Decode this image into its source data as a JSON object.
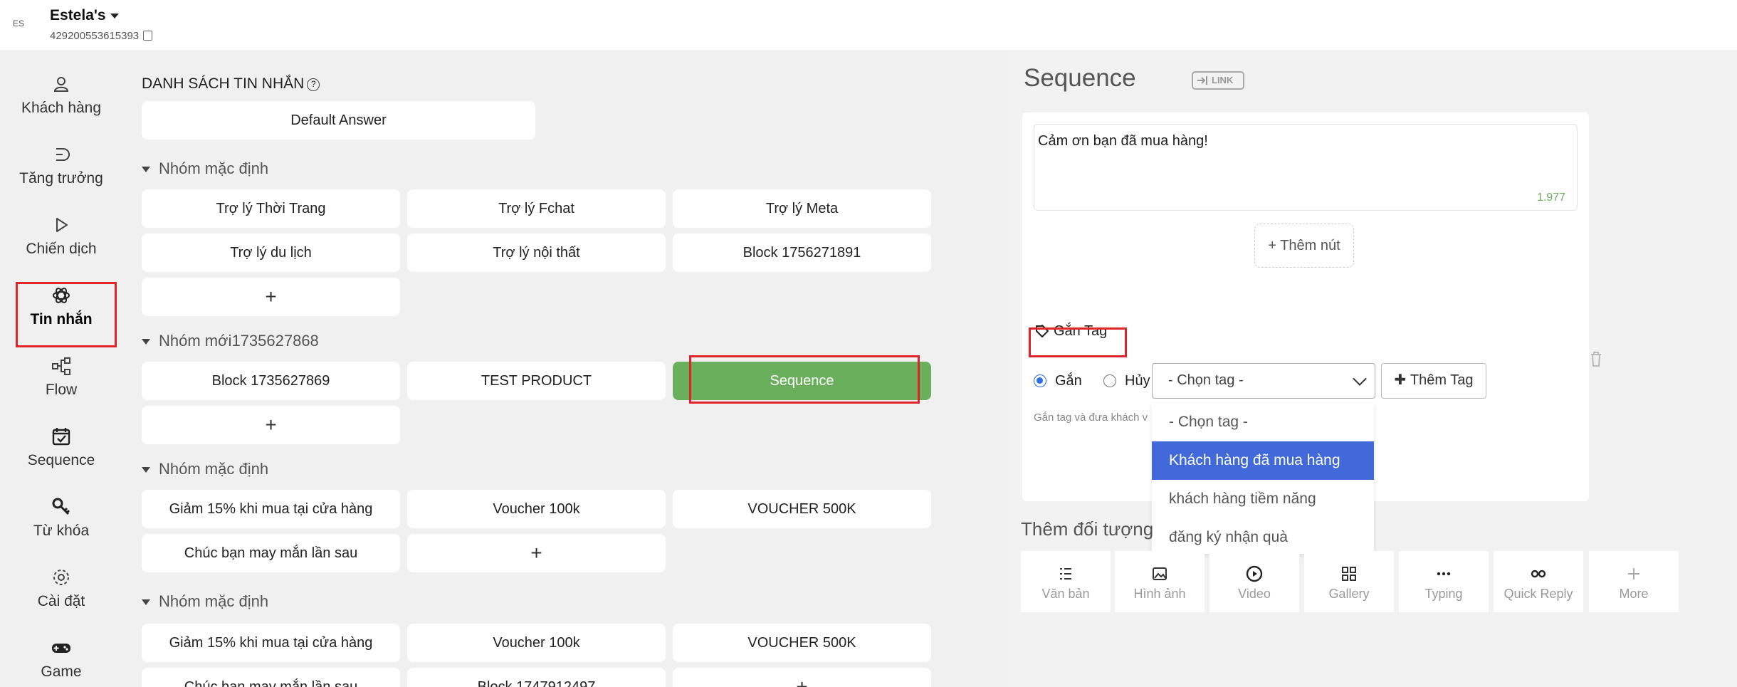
{
  "header": {
    "page_name": "Estela's",
    "page_id": "429200553615393",
    "logo_text": "ES"
  },
  "sidebar": {
    "items": [
      {
        "label": "Khách hàng",
        "icon": "user-icon"
      },
      {
        "label": "Tăng trưởng",
        "icon": "growth-icon"
      },
      {
        "label": "Chiến dịch",
        "icon": "play-icon"
      },
      {
        "label": "Tin nhắn",
        "icon": "message-atom-icon",
        "active": true
      },
      {
        "label": "Flow",
        "icon": "flow-icon"
      },
      {
        "label": "Sequence",
        "icon": "calendar-check-icon"
      },
      {
        "label": "Từ khóa",
        "icon": "key-icon"
      },
      {
        "label": "Cài đặt",
        "icon": "gear-icon"
      },
      {
        "label": "Game",
        "icon": "gamepad-icon"
      }
    ]
  },
  "messages": {
    "title": "DANH SÁCH TIN NHẮN",
    "default_answer": "Default Answer",
    "add_symbol": "+",
    "groups": [
      {
        "name": "Nhóm mặc định",
        "blocks": [
          "Trợ lý Thời Trang",
          "Trợ lý Fchat",
          "Trợ lý Meta",
          "Trợ lý du lịch",
          "Trợ lý nội thất",
          "Block 1756271891"
        ]
      },
      {
        "name": "Nhóm mới1735627868",
        "blocks": [
          "Block 1735627869",
          "TEST PRODUCT",
          "Sequence"
        ]
      },
      {
        "name": "Nhóm mặc định",
        "blocks": [
          "Giảm 15% khi mua tại cửa hàng",
          "Voucher 100k",
          "VOUCHER 500K",
          "Chúc bạn may mắn lần sau"
        ]
      },
      {
        "name": "Nhóm mặc định",
        "blocks": [
          "Giảm 15% khi mua tại cửa hàng",
          "Voucher 100k",
          "VOUCHER 500K",
          "Chúc bạn may mắn lần sau",
          "Block 1747912497"
        ]
      }
    ]
  },
  "editor": {
    "title": "Sequence",
    "link_label": "LINK",
    "message_text": "Cảm ơn bạn đã mua hàng!",
    "char_count": "1.977",
    "add_button_label": "+ Thêm nút",
    "tag": {
      "label": "Gắn Tag",
      "radio_assign": "Gắn",
      "radio_remove": "Hủy",
      "select_placeholder": "- Chọn tag -",
      "add_tag_label": "Thêm Tag",
      "hint": "Gắn tag và đưa khách v",
      "options": [
        "- Chọn tag -",
        "Khách hàng đã mua hàng",
        "khách hàng tiềm năng",
        "đăng ký nhận quà"
      ],
      "highlighted_option": "Khách hàng đã mua hàng"
    },
    "add_object_title": "Thêm đối tượng",
    "objects": [
      {
        "label": "Văn bản",
        "icon": "text-lines-icon"
      },
      {
        "label": "Hình ảnh",
        "icon": "image-icon"
      },
      {
        "label": "Video",
        "icon": "video-play-icon"
      },
      {
        "label": "Gallery",
        "icon": "gallery-grid-icon"
      },
      {
        "label": "Typing",
        "icon": "typing-dots-icon"
      },
      {
        "label": "Quick Reply",
        "icon": "quick-reply-icon"
      },
      {
        "label": "More",
        "icon": "plus-icon"
      }
    ]
  },
  "colors": {
    "accent_green": "#6aaf5b",
    "highlight_red": "#e0242b",
    "select_blue": "#4169d9"
  }
}
